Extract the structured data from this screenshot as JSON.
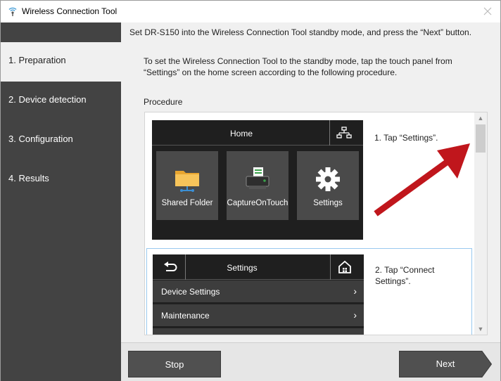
{
  "window": {
    "title": "Wireless Connection Tool"
  },
  "sidebar": {
    "items": [
      {
        "label": "1. Preparation",
        "active": true
      },
      {
        "label": "2. Device detection",
        "active": false
      },
      {
        "label": "3. Configuration",
        "active": false
      },
      {
        "label": "4. Results",
        "active": false
      }
    ]
  },
  "content": {
    "instruction": "Set DR-S150 into the Wireless Connection Tool standby mode, and press the “Next” button.",
    "description": "To set the Wireless Connection Tool to the standby mode, tap the touch panel from “Settings” on the home screen according to the following procedure.",
    "procedure_label": "Procedure",
    "steps": [
      {
        "text": "1. Tap “Settings”.",
        "screen": {
          "header": "Home",
          "tiles": [
            {
              "label": "Shared Folder",
              "icon": "folder-icon"
            },
            {
              "label": "CaptureOnTouch",
              "icon": "scanner-icon"
            },
            {
              "label": "Settings",
              "icon": "gear-icon"
            }
          ]
        }
      },
      {
        "text": "2. Tap “Connect Settings”.",
        "screen": {
          "header": "Settings",
          "rows": [
            {
              "label": "Device Settings"
            },
            {
              "label": "Maintenance"
            }
          ]
        }
      }
    ]
  },
  "footer": {
    "stop_label": "Stop",
    "next_label": "Next"
  },
  "colors": {
    "sidebar_bg": "#434343",
    "arrow": "#c0161c",
    "button_bg": "#505050"
  }
}
